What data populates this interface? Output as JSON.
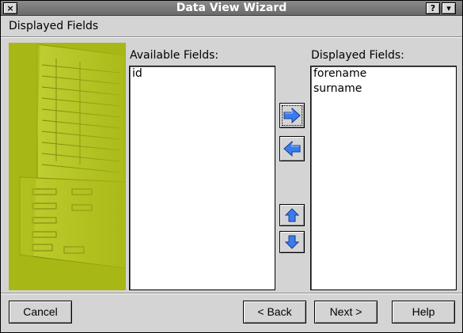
{
  "window": {
    "title": "Data View Wizard",
    "close_glyph": "×",
    "help_glyph": "?",
    "menu_glyph": "▾"
  },
  "page": {
    "heading": "Displayed Fields"
  },
  "available": {
    "label": "Available Fields:",
    "items": [
      "id"
    ]
  },
  "displayed": {
    "label": "Displayed Fields:",
    "items": [
      "forename",
      "surname"
    ]
  },
  "move_buttons": {
    "add_icon": "arrow-right-icon",
    "remove_icon": "arrow-left-icon",
    "up_icon": "arrow-up-icon",
    "down_icon": "arrow-down-icon"
  },
  "buttons": {
    "cancel": "Cancel",
    "back": "< Back",
    "next": "Next >",
    "help": "Help"
  },
  "colors": {
    "sidebar_green": "#a7b716",
    "arrow_blue": "#3a7cf0"
  }
}
